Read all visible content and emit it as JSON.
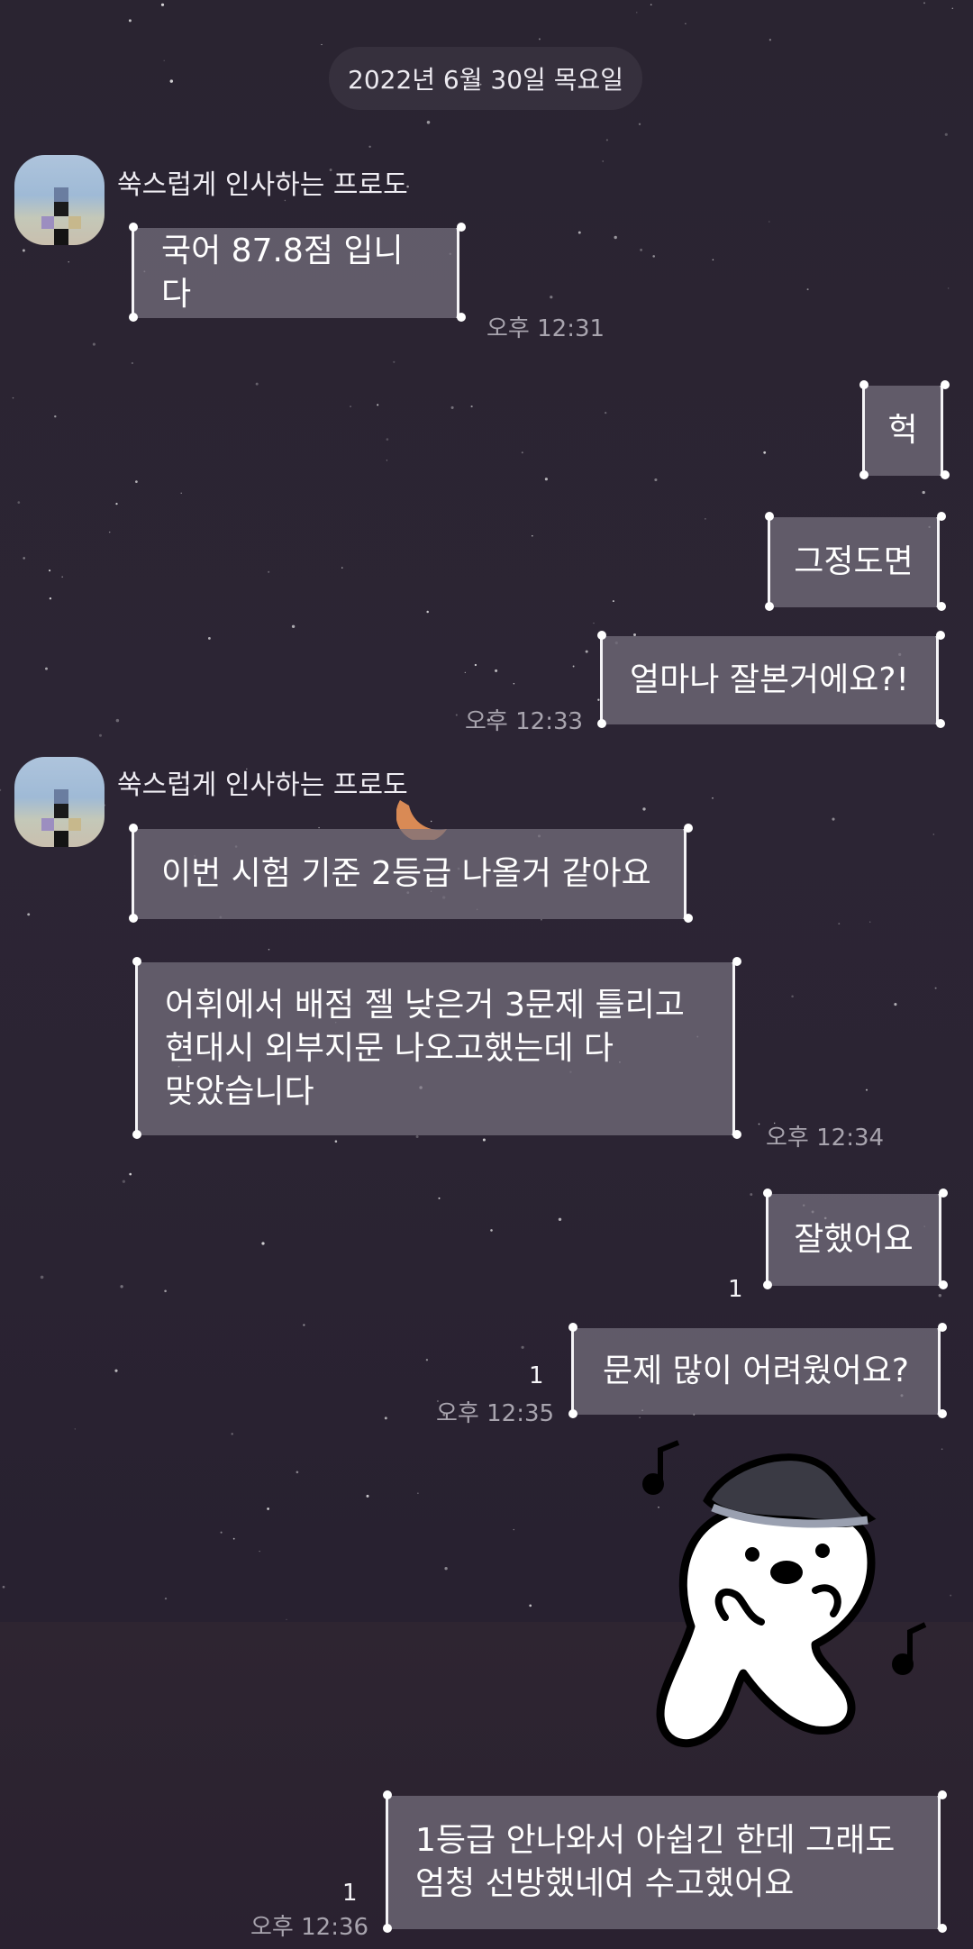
{
  "date_divider": "2022년 6월 30일 목요일",
  "sender_name": "쑥스럽게 인사하는 프로도",
  "messages": {
    "m1": {
      "text": "국어 87.8점 입니다",
      "time": "오후 12:31"
    },
    "m2": {
      "text": "헉"
    },
    "m3": {
      "text": "그정도면"
    },
    "m4": {
      "text": "얼마나 잘본거에요?!",
      "time": "오후 12:33"
    },
    "m5": {
      "text": "이번 시험 기준 2등급 나올거 같아요"
    },
    "m6": {
      "text": "어휘에서 배점 젤 낮은거 3문제 틀리고\n현대시 외부지문 나오고했는데 다\n맞았습니다",
      "time": "오후 12:34"
    },
    "m7": {
      "text": "잘했어요",
      "unread": "1"
    },
    "m8": {
      "text": "문제 많이 어려웠어요?",
      "unread": "1",
      "time": "오후 12:35"
    },
    "m9": {
      "text": "1등급 안나와서 아쉽긴 한데 그래도\n엄청 선방했네여 수고했어요",
      "unread": "1",
      "time": "오후 12:36"
    }
  },
  "icons": {
    "moon": "moon-icon",
    "sticker": "dancing-character-sticker"
  },
  "colors": {
    "background": "#2b2433",
    "bubble": "#76707e",
    "time_text": "#a8a4ae"
  }
}
